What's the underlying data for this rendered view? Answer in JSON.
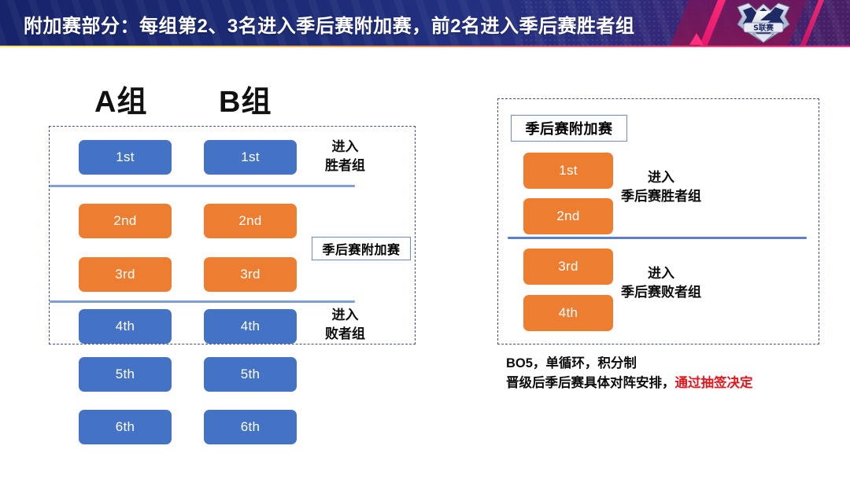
{
  "banner": {
    "title": "附加赛部分：每组第2、3名进入季后赛附加赛，前2名进入季后赛胜者组",
    "logo_text": "S联赛",
    "logo_name": "s-league-emblem",
    "background_color": "#1b2a73",
    "accent_color": "#ff2d86"
  },
  "left_section": {
    "group_a_heading": "A组",
    "group_b_heading": "B组",
    "columns": [
      {
        "group": "A组",
        "ranks": [
          {
            "label": "1st",
            "color": "#4472c4"
          },
          {
            "label": "2nd",
            "color": "#ed7d31"
          },
          {
            "label": "3rd",
            "color": "#ed7d31"
          },
          {
            "label": "4th",
            "color": "#4472c4"
          },
          {
            "label": "5th",
            "color": "#4472c4"
          },
          {
            "label": "6th",
            "color": "#4472c4"
          }
        ]
      },
      {
        "group": "B组",
        "ranks": [
          {
            "label": "1st",
            "color": "#4472c4"
          },
          {
            "label": "2nd",
            "color": "#ed7d31"
          },
          {
            "label": "3rd",
            "color": "#ed7d31"
          },
          {
            "label": "4th",
            "color": "#4472c4"
          },
          {
            "label": "5th",
            "color": "#4472c4"
          },
          {
            "label": "6th",
            "color": "#4472c4"
          }
        ]
      }
    ],
    "annotations": {
      "winners": "进入\n胜者组",
      "winners_line1": "进入",
      "winners_line2": "胜者组",
      "playoff_tiebreak": "季后赛附加赛",
      "losers_line1": "进入",
      "losers_line2": "败者组"
    }
  },
  "right_section": {
    "title": "季后赛附加赛",
    "ranks": [
      {
        "label": "1st",
        "color": "#ed7d31"
      },
      {
        "label": "2nd",
        "color": "#ed7d31"
      },
      {
        "label": "3rd",
        "color": "#ed7d31"
      },
      {
        "label": "4th",
        "color": "#ed7d31"
      }
    ],
    "annotations": {
      "upper_line1": "进入",
      "upper_line2": "季后赛胜者组",
      "lower_line1": "进入",
      "lower_line2": "季后赛败者组"
    },
    "notes": {
      "line1": "BO5，单循环，积分制",
      "line2_prefix": "晋级后季后赛具体对阵安排，",
      "line2_highlight": "通过抽签决定",
      "highlight_color": "#e8141c"
    }
  }
}
